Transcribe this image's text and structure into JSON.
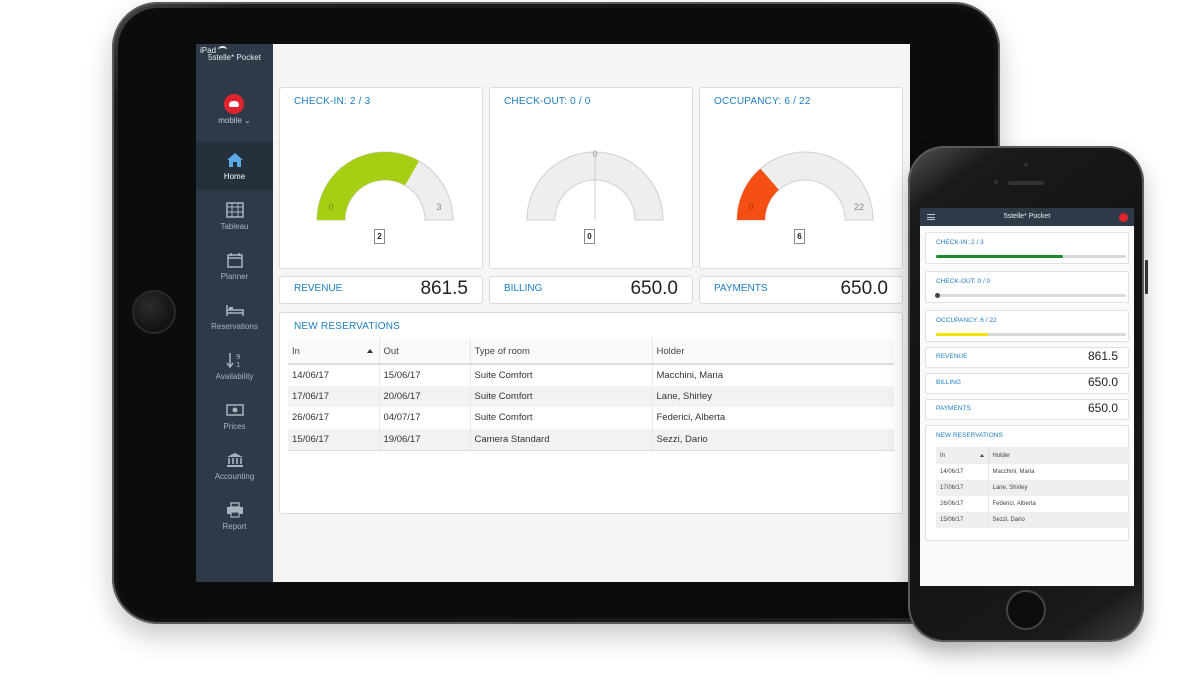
{
  "tablet": {
    "status": {
      "device": "iPad"
    },
    "app_name": "5stelle* Pocket",
    "account": "mobile",
    "nav": [
      {
        "label": "Home",
        "icon": "home-icon",
        "active": true
      },
      {
        "label": "Tableau",
        "icon": "table-icon"
      },
      {
        "label": "Planner",
        "icon": "calendar-icon"
      },
      {
        "label": "Reservations",
        "icon": "bed-icon"
      },
      {
        "label": "Availability",
        "icon": "sort-numeric-icon"
      },
      {
        "label": "Prices",
        "icon": "money-icon"
      },
      {
        "label": "Accounting",
        "icon": "bank-icon"
      },
      {
        "label": "Report",
        "icon": "print-icon"
      }
    ],
    "gauges": [
      {
        "title": "CHECK-IN: 2 / 3",
        "value": 2,
        "max": 3,
        "min_label": "0",
        "max_label": "3",
        "color": "#a6ce12"
      },
      {
        "title": "CHECK-OUT: 0 / 0",
        "value": 0,
        "max": 0,
        "min_label": "0",
        "max_label": "",
        "color": "#a6ce12"
      },
      {
        "title": "OCCUPANCY: 6 / 22",
        "value": 6,
        "max": 22,
        "min_label": "0",
        "max_label": "22",
        "color": "#f54f14"
      }
    ],
    "gauge_values": [
      "2",
      "0",
      "6"
    ],
    "stats": [
      {
        "label": "REVENUE",
        "value": "861.5"
      },
      {
        "label": "BILLING",
        "value": "650.0"
      },
      {
        "label": "PAYMENTS",
        "value": "650.0"
      }
    ],
    "reservations": {
      "title": "NEW RESERVATIONS",
      "columns": [
        "In",
        "Out",
        "Type of room",
        "Holder"
      ],
      "rows": [
        [
          "14/06/17",
          "15/06/17",
          "Suite Comfort",
          "Macchini, Maria"
        ],
        [
          "17/06/17",
          "20/06/17",
          "Suite Comfort",
          "Lane, Shirley"
        ],
        [
          "26/06/17",
          "04/07/17",
          "Suite Comfort",
          "Federici, Alberta"
        ],
        [
          "15/06/17",
          "19/06/17",
          "Camera Standard",
          "Sezzi, Dario"
        ]
      ]
    }
  },
  "phone": {
    "title": "5stelle* Pocket",
    "progress": [
      {
        "title": "CHECK-IN: 2 / 3",
        "fraction": 0.667,
        "color": "#1e8a2e"
      },
      {
        "title": "CHECK-OUT: 0 / 0",
        "fraction": 0,
        "color": "#444444"
      },
      {
        "title": "OCCUPANCY: 6 / 22",
        "fraction": 0.273,
        "color": "#f5e20a"
      }
    ],
    "stats": [
      {
        "label": "REVENUE",
        "value": "861.5"
      },
      {
        "label": "BILLING",
        "value": "650.0"
      },
      {
        "label": "PAYMENTS",
        "value": "650.0"
      }
    ],
    "reservations": {
      "title": "NEW RESERVATIONS",
      "columns": [
        "In",
        "Holder"
      ],
      "rows": [
        [
          "14/06/17",
          "Macchini, Maria"
        ],
        [
          "17/06/17",
          "Lane, Shirley"
        ],
        [
          "26/06/17",
          "Federici, Alberta"
        ],
        [
          "15/06/17",
          "Sezzi, Dario"
        ]
      ]
    }
  }
}
